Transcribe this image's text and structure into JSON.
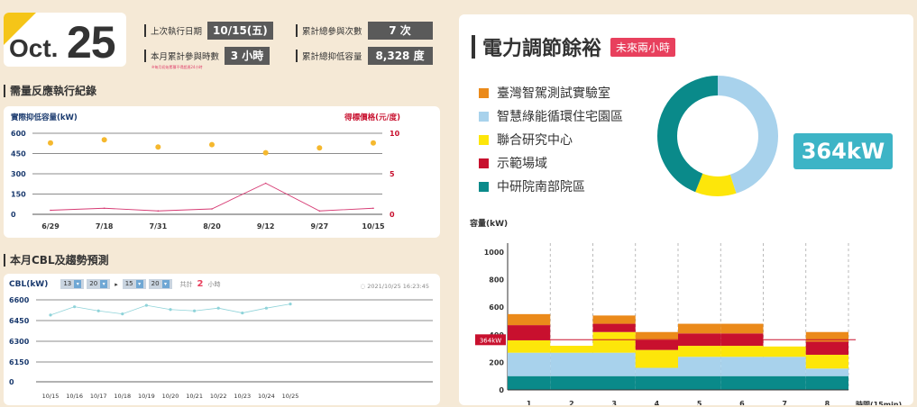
{
  "header": {
    "month": "Oct.",
    "day": "25",
    "last_exec_label": "上次執行日期",
    "last_exec_value": "10/15(五)",
    "total_participation_label": "累計總參與次數",
    "total_participation_value": "7 次",
    "month_hours_label": "本月累計參與時數",
    "month_hours_value": "3 小時",
    "total_reduction_label": "累計總抑低容量",
    "total_reduction_value": "8,328 度",
    "note": "※每月初始累積不得超過24小時"
  },
  "demand_section": {
    "title": "需量反應執行紀錄",
    "left_axis_label": "實際抑低容量(kW)",
    "right_axis_label": "得標價格(元/度)"
  },
  "cbl_section": {
    "title": "本月CBL及趨勢預測",
    "controls": {
      "cbl_label": "CBL(kW)",
      "from_month": "13",
      "from_day": "20",
      "to_month": "15",
      "to_day": "20",
      "total_label": "共計",
      "total_value": "2",
      "unit_label": "小時",
      "timestamp": "2021/10/25 16:23:45"
    }
  },
  "power_section": {
    "title": "電力調節餘裕",
    "tag": "未來兩小時",
    "kw_value": "364kW",
    "y_axis_label": "容量(kW)",
    "x_axis_label": "時間(15min)",
    "marker_label": "364kW"
  },
  "colors": {
    "orange": "#eb8a1a",
    "light_blue": "#a8d2ec",
    "yellow": "#fde60a",
    "red": "#c8102e",
    "teal": "#0a8a8a",
    "accent_pink": "#e8405d",
    "accent_cyan": "#3db4c6"
  },
  "chart_data": [
    {
      "type": "line",
      "id": "demand_response",
      "x": [
        "6/29",
        "7/18",
        "7/31",
        "8/20",
        "9/12",
        "9/27",
        "10/15"
      ],
      "series": [
        {
          "name": "實際抑低容量(kW)",
          "axis": "left",
          "values": [
            30,
            45,
            25,
            40,
            230,
            25,
            45
          ]
        },
        {
          "name": "得標價格(元/度)",
          "axis": "right",
          "values": [
            8.8,
            9.2,
            8.3,
            8.6,
            7.6,
            8.2,
            8.8
          ]
        }
      ],
      "ylim": [
        0,
        600
      ],
      "yticks": [
        0,
        150,
        300,
        450,
        600
      ],
      "y2lim": [
        0,
        10
      ],
      "y2ticks": [
        0,
        5,
        10
      ]
    },
    {
      "type": "line",
      "id": "cbl_trend",
      "x": [
        "10/15",
        "10/16",
        "10/17",
        "10/18",
        "10/19",
        "10/20",
        "10/21",
        "10/22",
        "10/23",
        "10/24",
        "10/25"
      ],
      "series": [
        {
          "name": "CBL",
          "values": [
            6490,
            6550,
            6520,
            6498,
            6560,
            6530,
            6520,
            6540,
            6505,
            6540,
            6570
          ]
        }
      ],
      "yticks": [
        0,
        6150,
        6300,
        6450,
        6600
      ]
    },
    {
      "type": "pie",
      "id": "site_share",
      "categories": [
        "臺灣智駕測試實驗室",
        "智慧綠能循環住宅園區",
        "聯合研究中心",
        "示範場域",
        "中研院南部院區"
      ],
      "values": [
        0,
        45,
        11,
        0,
        44
      ]
    },
    {
      "type": "bar",
      "id": "capacity_forecast",
      "stacked": true,
      "categories": [
        "1",
        "2",
        "3",
        "4",
        "5",
        "6",
        "7",
        "8"
      ],
      "series": [
        {
          "name": "中研院南部院區",
          "values": [
            100,
            100,
            100,
            100,
            100,
            100,
            100,
            100
          ]
        },
        {
          "name": "智慧綠能循環住宅園區",
          "values": [
            170,
            170,
            170,
            60,
            140,
            140,
            140,
            55
          ]
        },
        {
          "name": "聯合研究中心",
          "values": [
            90,
            50,
            150,
            130,
            80,
            80,
            75,
            100
          ]
        },
        {
          "name": "示範場域",
          "values": [
            110,
            0,
            60,
            70,
            90,
            90,
            0,
            95
          ]
        },
        {
          "name": "臺灣智駕測試實驗室",
          "values": [
            80,
            0,
            60,
            60,
            70,
            70,
            0,
            70
          ]
        }
      ],
      "ylim": [
        0,
        1000
      ],
      "yticks": [
        0,
        200,
        400,
        600,
        800,
        1000
      ],
      "reference_line": 364
    }
  ]
}
